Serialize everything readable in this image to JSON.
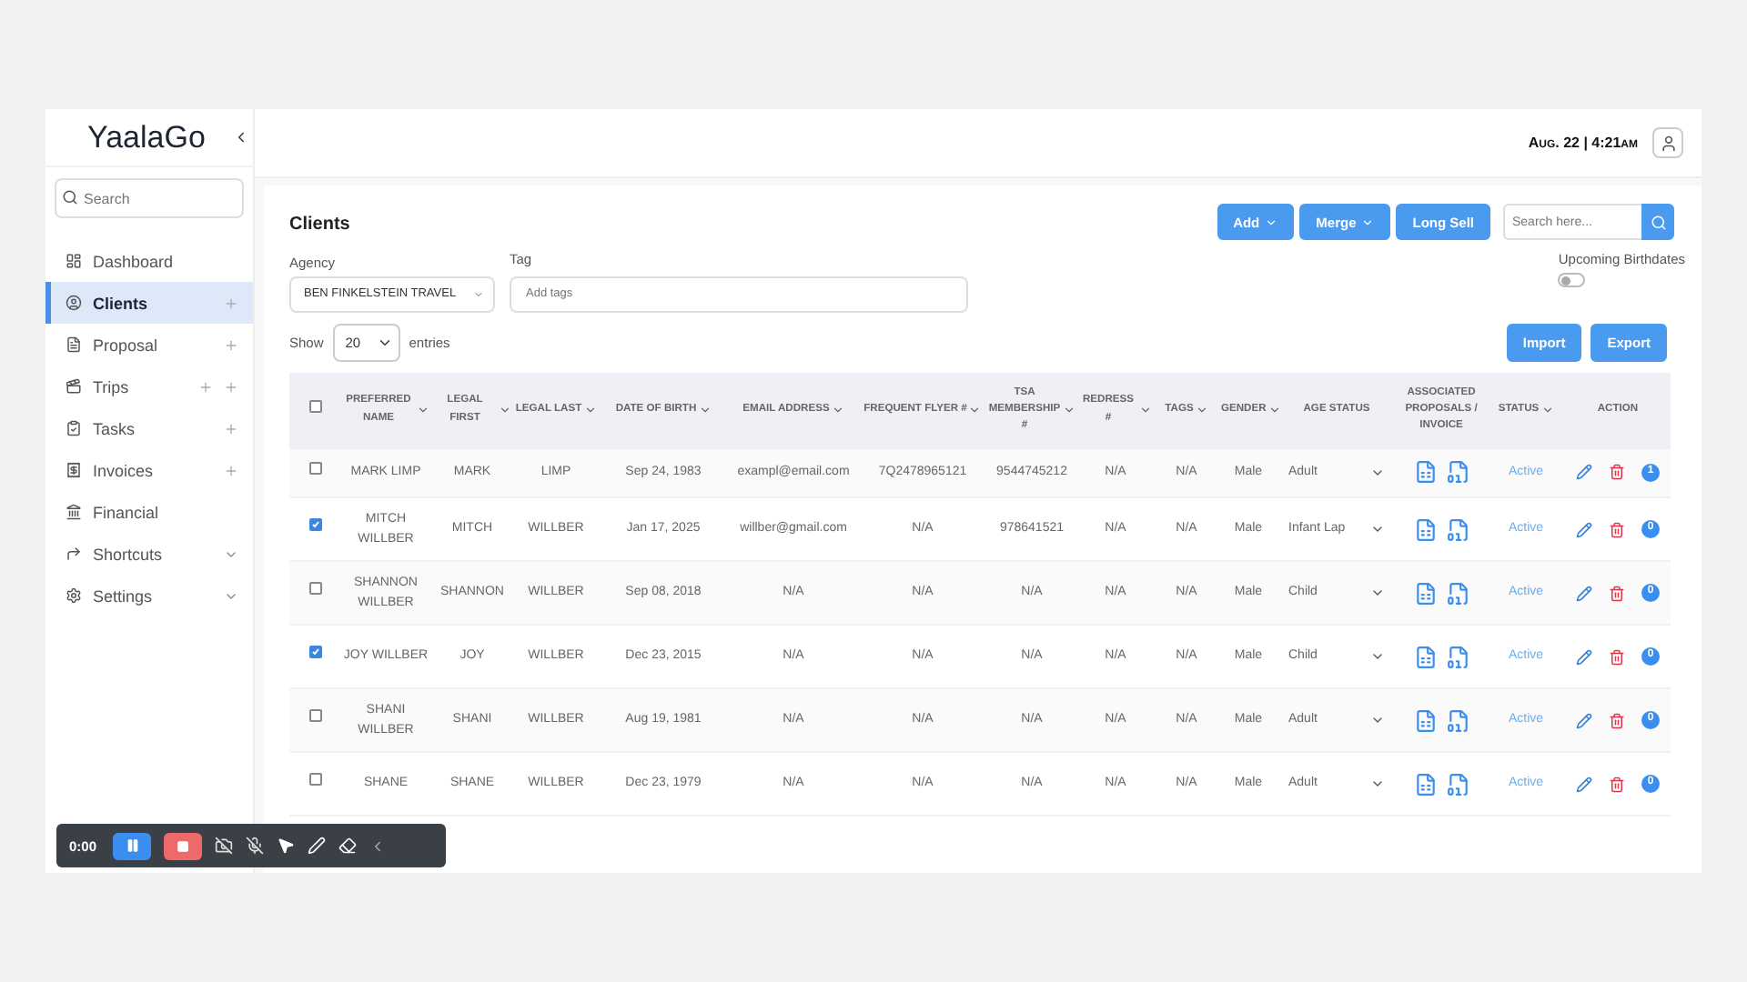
{
  "brand": "YaalaGo",
  "header": {
    "datetime": "Aug. 22 | 4:21am"
  },
  "sidebar": {
    "search": {
      "placeholder": "Search"
    },
    "items": [
      {
        "label": "Dashboard",
        "kind": "plain",
        "selected": false
      },
      {
        "label": "Clients",
        "kind": "single_add",
        "selected": true
      },
      {
        "label": "Proposal",
        "kind": "single_add",
        "selected": false
      },
      {
        "label": "Trips",
        "kind": "double_add",
        "selected": false
      },
      {
        "label": "Tasks",
        "kind": "single_add",
        "selected": false
      },
      {
        "label": "Invoices",
        "kind": "single_add",
        "selected": false
      },
      {
        "label": "Financial",
        "kind": "plain",
        "selected": false
      },
      {
        "label": "Shortcuts",
        "kind": "collapsible",
        "selected": false
      },
      {
        "label": "Settings",
        "kind": "collapsible",
        "selected": false
      }
    ]
  },
  "page": {
    "title": "Clients",
    "actions": [
      {
        "label": "Add",
        "dropdown": true
      },
      {
        "label": "Merge",
        "dropdown": true
      },
      {
        "label": "Long Sell",
        "dropdown": false
      }
    ],
    "search": {
      "placeholder": "Search here..."
    },
    "agency": {
      "label": "Agency",
      "value": "BEN FINKELSTEIN TRAVEL"
    },
    "tag": {
      "label": "Tag",
      "placeholder": "Add tags"
    },
    "birthdates": {
      "label": "Upcoming Birthdates",
      "on": false
    },
    "show": {
      "before": "Show",
      "value": "20",
      "after": "entries"
    },
    "tools": [
      "Import",
      "Export"
    ]
  },
  "table": {
    "select_all": {
      "checked": false
    },
    "columns": [
      {
        "label": "PREFERRED NAME",
        "sortable": true
      },
      {
        "label": "LEGAL FIRST",
        "sortable": true
      },
      {
        "label": "LEGAL LAST",
        "sortable": true
      },
      {
        "label": "DATE OF BIRTH",
        "sortable": true
      },
      {
        "label": "EMAIL ADDRESS",
        "sortable": true
      },
      {
        "label": "FREQUENT FLYER #",
        "sortable": true
      },
      {
        "label": "TSA MEMBERSHIP #",
        "sortable": true
      },
      {
        "label": "REDRESS #",
        "sortable": true
      },
      {
        "label": "TAGS",
        "sortable": true
      },
      {
        "label": "GENDER",
        "sortable": true
      },
      {
        "label": "AGE STATUS",
        "sortable": false
      },
      {
        "label": "ASSOCIATED PROPOSALS / INVOICE",
        "sortable": false
      },
      {
        "label": "STATUS",
        "sortable": true
      },
      {
        "label": "ACTION",
        "sortable": false
      }
    ],
    "rows": [
      {
        "checked": false,
        "cells": [
          "MARK LIMP",
          "MARK",
          "LIMP",
          "Sep 24, 1983",
          "exampl@email.com",
          "7Q2478965121",
          "9544745212",
          "N/A",
          "N/A",
          "Male"
        ],
        "age_status": "Adult",
        "status": "Active",
        "count": "1"
      },
      {
        "checked": true,
        "cells": [
          "MITCH WILLBER",
          "MITCH",
          "WILLBER",
          "Jan 17, 2025",
          "willber@gmail.com",
          "N/A",
          "978641521",
          "N/A",
          "N/A",
          "Male"
        ],
        "age_status": "Infant Lap",
        "status": "Active",
        "count": "0"
      },
      {
        "checked": false,
        "cells": [
          "SHANNON WILLBER",
          "SHANNON",
          "WILLBER",
          "Sep 08, 2018",
          "N/A",
          "N/A",
          "N/A",
          "N/A",
          "N/A",
          "Male"
        ],
        "age_status": "Child",
        "status": "Active",
        "count": "0"
      },
      {
        "checked": true,
        "cells": [
          "JOY WILLBER",
          "JOY",
          "WILLBER",
          "Dec 23, 2015",
          "N/A",
          "N/A",
          "N/A",
          "N/A",
          "N/A",
          "Male"
        ],
        "age_status": "Child",
        "status": "Active",
        "count": "0"
      },
      {
        "checked": false,
        "cells": [
          "SHANI WILLBER",
          "SHANI",
          "WILLBER",
          "Aug 19, 1981",
          "N/A",
          "N/A",
          "N/A",
          "N/A",
          "N/A",
          "Male"
        ],
        "age_status": "Adult",
        "status": "Active",
        "count": "0"
      },
      {
        "checked": false,
        "cells": [
          "SHANE",
          "SHANE",
          "WILLBER",
          "Dec 23, 1979",
          "N/A",
          "N/A",
          "N/A",
          "N/A",
          "N/A",
          "Male"
        ],
        "age_status": "Adult",
        "status": "Active",
        "count": "0"
      }
    ]
  },
  "recorder": {
    "time": "0:00"
  }
}
